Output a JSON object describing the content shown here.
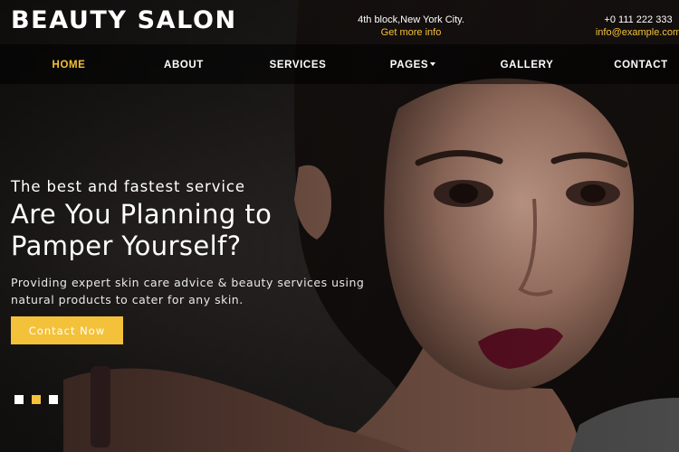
{
  "brand": {
    "name": "BEAUTY SALON"
  },
  "header": {
    "address": {
      "line1": "4th block,New York City.",
      "line2": "Get more info"
    },
    "phone": {
      "line1": "+0 111 222 333",
      "line2": "info@example.com"
    }
  },
  "nav": {
    "items": [
      {
        "label": "HOME",
        "active": true
      },
      {
        "label": "ABOUT",
        "active": false
      },
      {
        "label": "SERVICES",
        "active": false
      },
      {
        "label": "PAGES",
        "active": false,
        "dropdown": true
      },
      {
        "label": "GALLERY",
        "active": false
      },
      {
        "label": "CONTACT",
        "active": false
      }
    ]
  },
  "hero": {
    "eyebrow": "The best and fastest service",
    "headline_line1": "Are You Planning to",
    "headline_line2": "Pamper Yourself?",
    "sub_line1": "Providing expert skin care advice & beauty services using",
    "sub_line2": "natural products to cater for any skin.",
    "cta_label": "Contact Now"
  },
  "slider": {
    "count": 3,
    "active_index": 1
  },
  "colors": {
    "accent": "#f3c13a",
    "nav_bg": "#000000",
    "text": "#ffffff"
  }
}
